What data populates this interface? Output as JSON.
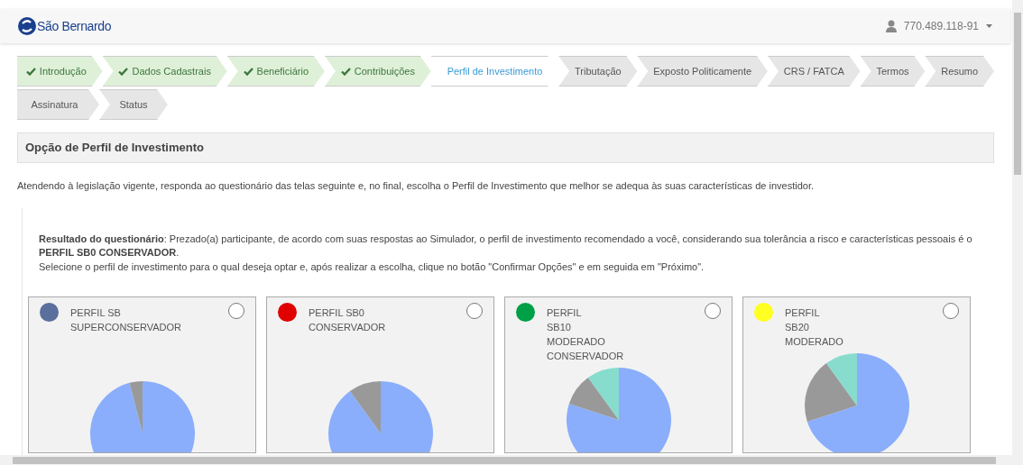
{
  "header": {
    "brand": "São Bernardo",
    "user": "770.489.118-91"
  },
  "steps": [
    {
      "label": "Introdução",
      "completed": true,
      "selected": false
    },
    {
      "label": "Dados Cadastrais",
      "completed": true,
      "selected": false
    },
    {
      "label": "Beneficiário",
      "completed": true,
      "selected": false
    },
    {
      "label": "Contribuições",
      "completed": true,
      "selected": false
    },
    {
      "label": "Perfil de Investimento",
      "completed": false,
      "selected": true
    },
    {
      "label": "Tributação",
      "completed": false,
      "selected": false
    },
    {
      "label": "Exposto Politicamente",
      "completed": false,
      "selected": false
    },
    {
      "label": "CRS / FATCA",
      "completed": false,
      "selected": false
    },
    {
      "label": "Termos",
      "completed": false,
      "selected": false
    },
    {
      "label": "Resumo",
      "completed": false,
      "selected": false
    },
    {
      "label": "Assinatura",
      "completed": false,
      "selected": false
    },
    {
      "label": "Status",
      "completed": false,
      "selected": false
    }
  ],
  "section_title": "Opção de Perfil de Investimento",
  "intro": "Atendendo à legislação vigente, responda ao questionário das telas seguinte e, no final, escolha o Perfil de Investimento que melhor se adequa às suas características de investidor.",
  "result": "**Resultado do questionário**: Prezado(a) participante, de acordo com suas respostas ao Simulador, o perfil de investimento recomendado a você, considerando sua tolerância a risco e características pessoais é o **PERFIL SB0 CONSERVADOR**.",
  "instruction": "Selecione o perfil de investimento para o qual deseja optar e, após realizar a escolha, clique no botão \"Confirmar Opções\" e em seguida em \"Próximo\".",
  "profiles": [
    {
      "lines": [
        "PERFIL SB",
        "SUPERCONSERVADOR"
      ],
      "color": "#5a6f9b",
      "selected": false
    },
    {
      "lines": [
        "PERFIL SB0",
        "CONSERVADOR"
      ],
      "color": "#e00000",
      "selected": false
    },
    {
      "lines": [
        "PERFIL",
        "SB10",
        "MODERADO",
        "CONSERVADOR"
      ],
      "color": "#00a046",
      "selected": false
    },
    {
      "lines": [
        "PERFIL",
        "SB20",
        "MODERADO"
      ],
      "color": "#ffff22",
      "selected": false
    }
  ]
}
